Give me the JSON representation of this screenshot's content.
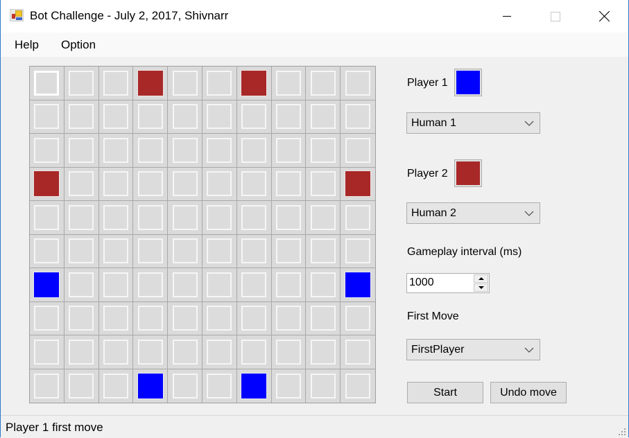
{
  "window": {
    "title": "Bot Challenge - July 2, 2017, Shivnarr",
    "controls": {
      "minimize": "minimize-icon",
      "maximize": "maximize-icon",
      "close": "close-icon"
    }
  },
  "menu": {
    "items": [
      {
        "label": "Help"
      },
      {
        "label": "Option"
      }
    ]
  },
  "board": {
    "rows": 10,
    "cols": 10,
    "focused_cell": [
      0,
      0
    ],
    "pieces": [
      {
        "row": 0,
        "col": 3,
        "player": 2
      },
      {
        "row": 0,
        "col": 6,
        "player": 2
      },
      {
        "row": 3,
        "col": 0,
        "player": 2
      },
      {
        "row": 3,
        "col": 9,
        "player": 2
      },
      {
        "row": 6,
        "col": 0,
        "player": 1
      },
      {
        "row": 6,
        "col": 9,
        "player": 1
      },
      {
        "row": 9,
        "col": 3,
        "player": 1
      },
      {
        "row": 9,
        "col": 6,
        "player": 1
      }
    ]
  },
  "panel": {
    "player1": {
      "label": "Player 1",
      "color": "#0000ff",
      "type": "Human 1"
    },
    "player2": {
      "label": "Player 2",
      "color": "#a82828",
      "type": "Human 2"
    },
    "interval": {
      "label": "Gameplay interval (ms)",
      "value": "1000"
    },
    "first_move": {
      "label": "First Move",
      "value": "FirstPlayer"
    },
    "buttons": {
      "start": "Start",
      "undo": "Undo move"
    }
  },
  "status": {
    "text": "Player 1 first move"
  }
}
